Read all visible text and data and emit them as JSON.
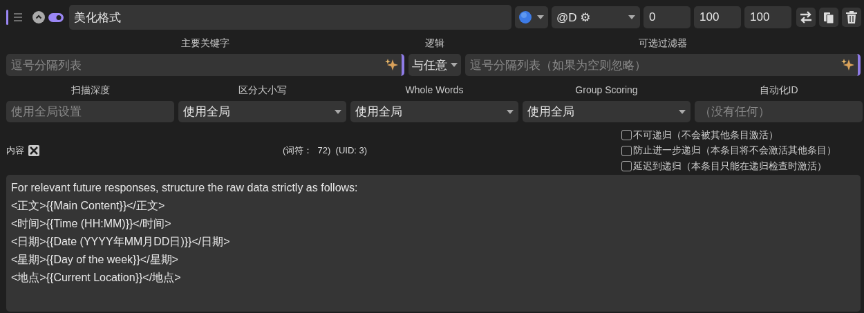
{
  "header": {
    "title": "美化格式",
    "enabled": true,
    "strategy": "@D ⚙",
    "order": "0",
    "depth_value": "100",
    "probability": "100"
  },
  "keywords": {
    "primary_label": "主要关键字",
    "primary_placeholder": "逗号分隔列表",
    "logic_label": "逻辑",
    "logic": "与任意",
    "filter_label": "可选过滤器",
    "filter_placeholder": "逗号分隔列表（如果为空则忽略）"
  },
  "options": [
    {
      "kind": "input",
      "label": "扫描深度",
      "placeholder": "使用全局设置"
    },
    {
      "kind": "select",
      "label": "区分大小写",
      "value": "使用全局"
    },
    {
      "kind": "select",
      "label": "Whole Words",
      "value": "使用全局"
    },
    {
      "kind": "select",
      "label": "Group Scoring",
      "value": "使用全局"
    },
    {
      "kind": "input",
      "label": "自动化ID",
      "placeholder": "（没有任何）"
    }
  ],
  "content": {
    "label": "内容",
    "tokens": "(词符：  72)",
    "uid": "(UID: 3)",
    "checkboxes": [
      {
        "label": "不可递归（不会被其他条目激活）",
        "checked": false
      },
      {
        "label": "防止进一步递归（本条目将不会激活其他条目）",
        "checked": false
      },
      {
        "label": "延迟到递归（本条目只能在递归检查时激活）",
        "checked": false
      }
    ],
    "lines": [
      "For relevant future responses, structure the raw data strictly as follows:",
      "<正文>{{Main Content}}</正文>",
      "<时间>{{Time (HH:MM)}}</时间>",
      "<日期>{{Date (YYYY年MM月DD日)}}</日期>",
      "<星期>{{Day of the week}}</星期>",
      "<地点>{{Current Location}}</地点>"
    ]
  }
}
